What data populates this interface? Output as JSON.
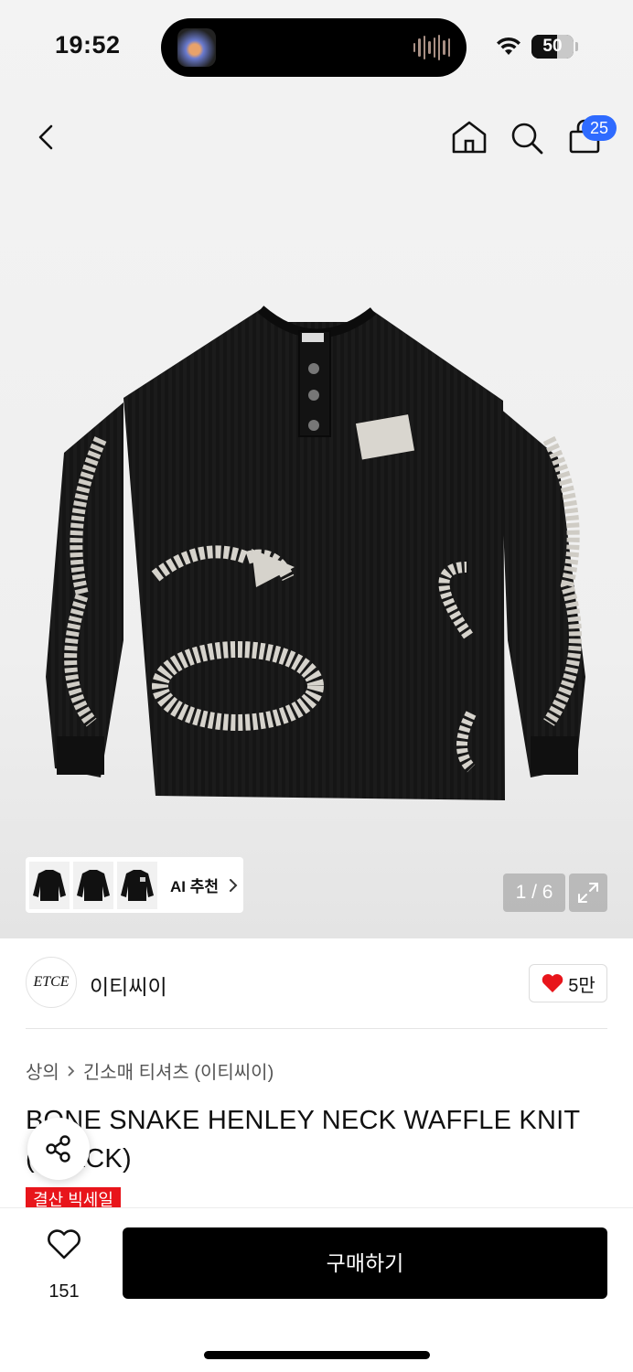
{
  "status_bar": {
    "time": "19:52",
    "battery": "50",
    "icons": [
      "now-playing-art",
      "audio-wave",
      "wifi-icon",
      "battery-icon"
    ]
  },
  "nav": {
    "icons": [
      "back-icon",
      "home-icon",
      "search-icon",
      "shopping-bag-icon"
    ],
    "cart_count": "25"
  },
  "gallery": {
    "ai_label": "AI 추천",
    "counter": "1 / 6",
    "thumbnails": 3
  },
  "brand": {
    "logo_text": "ETCE",
    "name": "이티씨이",
    "likes": "5만"
  },
  "breadcrumb": [
    "상의",
    "긴소매 티셔츠 (이티씨이)"
  ],
  "product": {
    "title": "BONE SNAKE HENLEY NECK WAFFLE KNIT (BLACK)",
    "sale_tag": "결산 빅세일"
  },
  "bottom_bar": {
    "wish_count": "151",
    "buy_label": "구매하기"
  },
  "colors": {
    "accent_blue": "#2f6bff",
    "sale_red": "#e8151b",
    "heart_red": "#e8151b",
    "buy_button": "#000000"
  }
}
